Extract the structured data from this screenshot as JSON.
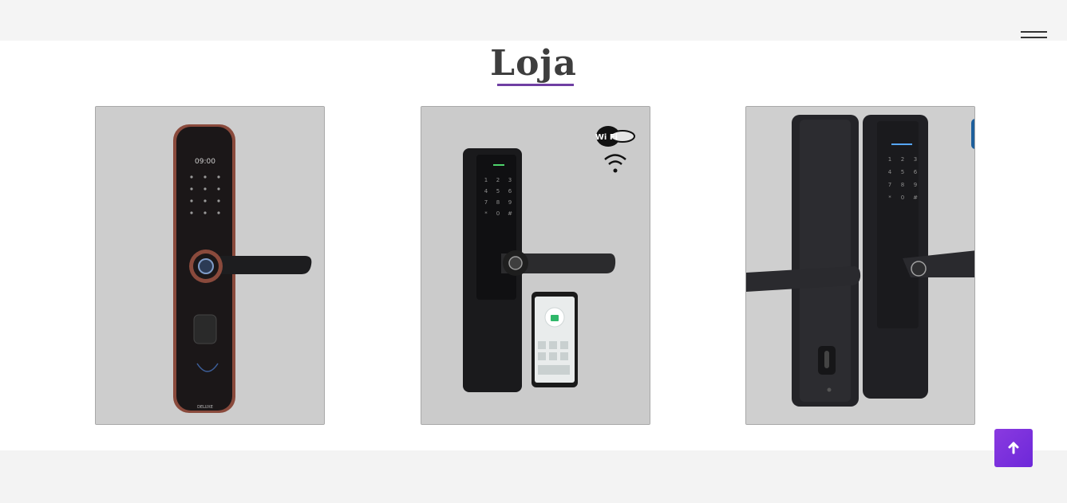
{
  "header": {
    "menu_icon": "hamburger-menu-icon"
  },
  "shop": {
    "title": "Loja",
    "products": [
      {
        "name": "smart-lock-copper",
        "screen_text": "09:00",
        "brand_text": "DELUXE"
      },
      {
        "name": "smart-lock-wifi-app",
        "badge_text": "Wi Fi"
      },
      {
        "name": "smart-lock-black-pair"
      }
    ]
  },
  "colors": {
    "accent": "#6f3fa3",
    "button": "#7b33dc"
  },
  "back_to_top": {
    "icon": "arrow-up-icon"
  }
}
